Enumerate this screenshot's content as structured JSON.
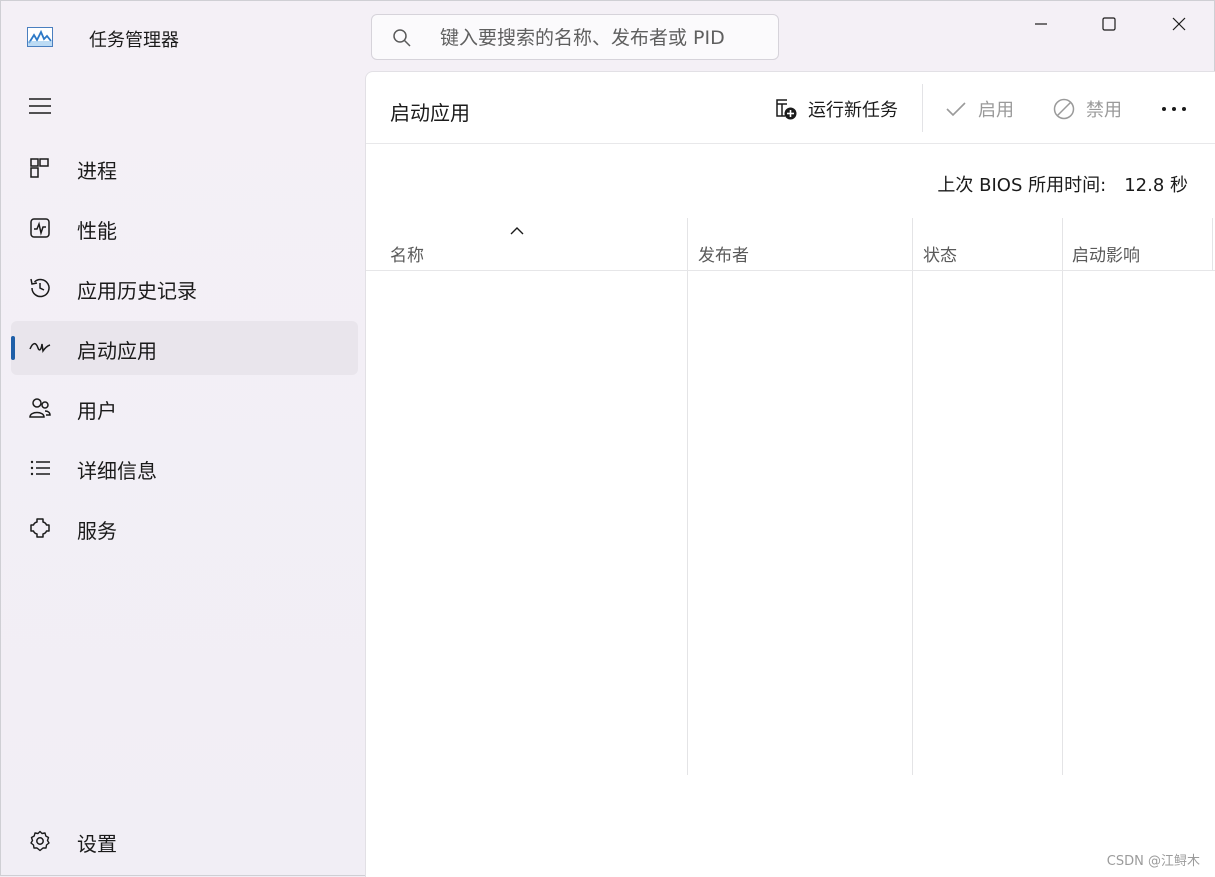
{
  "window": {
    "title": "任务管理器",
    "search": {
      "placeholder": "键入要搜索的名称、发布者或 PID",
      "value": ""
    }
  },
  "sidebar": {
    "items": [
      {
        "label": "进程",
        "icon": "processes-icon",
        "active": false
      },
      {
        "label": "性能",
        "icon": "performance-icon",
        "active": false
      },
      {
        "label": "应用历史记录",
        "icon": "history-icon",
        "active": false
      },
      {
        "label": "启动应用",
        "icon": "startup-icon",
        "active": true
      },
      {
        "label": "用户",
        "icon": "users-icon",
        "active": false
      },
      {
        "label": "详细信息",
        "icon": "details-icon",
        "active": false
      },
      {
        "label": "服务",
        "icon": "services-icon",
        "active": false
      }
    ],
    "settings_label": "设置"
  },
  "main": {
    "title": "启动应用",
    "toolbar": {
      "run_new_task": "运行新任务",
      "enable": "启用",
      "disable": "禁用"
    },
    "bios": {
      "label": "上次 BIOS 所用时间:",
      "value": "12.8 秒"
    },
    "table": {
      "columns": [
        "名称",
        "发布者",
        "状态",
        "启动影响"
      ],
      "sorted_column": "名称",
      "sort_direction": "ascending",
      "rows": []
    }
  },
  "watermark": "CSDN @江鲟木",
  "colors": {
    "accent": "#1f5fa8",
    "active_bg": "#e9e5ec",
    "disabled_text": "#9a9a9a"
  }
}
